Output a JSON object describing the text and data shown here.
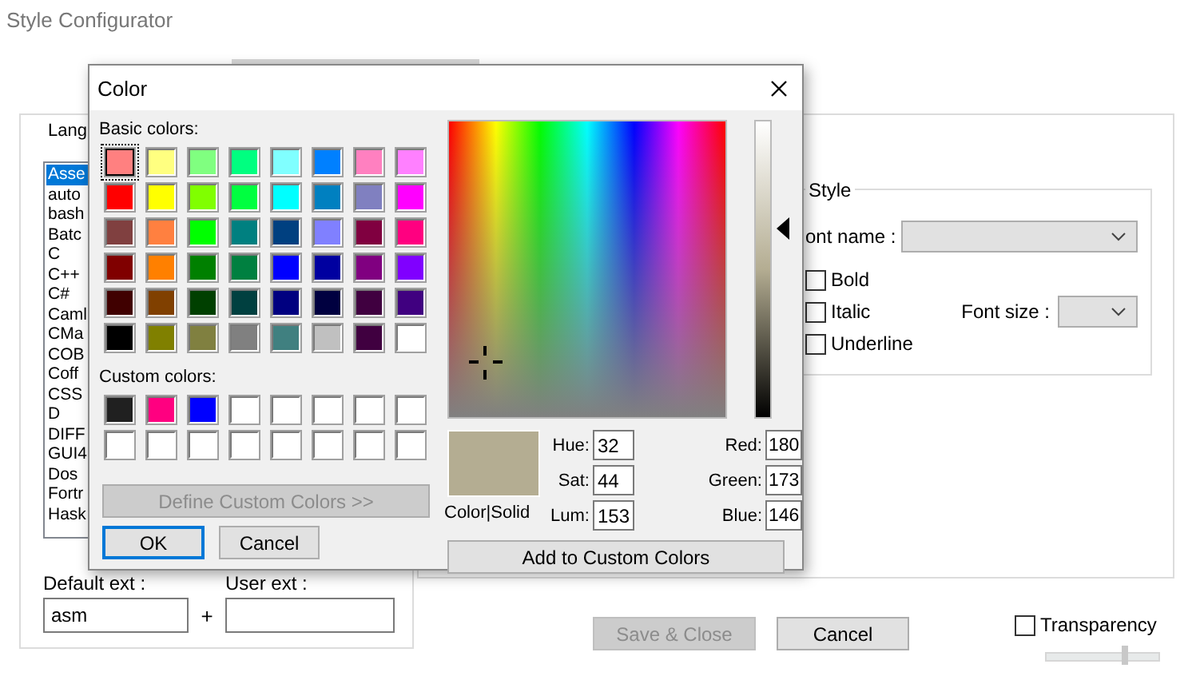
{
  "window": {
    "title": "Style Configurator"
  },
  "language_panel": {
    "label": "Lang",
    "items": [
      {
        "label": "Asse",
        "selected": true
      },
      {
        "label": "auto",
        "selected": false
      },
      {
        "label": "bash",
        "selected": false
      },
      {
        "label": "Batc",
        "selected": false
      },
      {
        "label": "C",
        "selected": false
      },
      {
        "label": "C++",
        "selected": false
      },
      {
        "label": "C#",
        "selected": false
      },
      {
        "label": "Caml",
        "selected": false
      },
      {
        "label": "CMa",
        "selected": false
      },
      {
        "label": "COB",
        "selected": false
      },
      {
        "label": "Coff",
        "selected": false
      },
      {
        "label": "CSS",
        "selected": false
      },
      {
        "label": "D",
        "selected": false
      },
      {
        "label": "DIFF",
        "selected": false
      },
      {
        "label": "GUI4",
        "selected": false
      },
      {
        "label": "Dos",
        "selected": false
      },
      {
        "label": "Fortr",
        "selected": false
      },
      {
        "label": "Hask",
        "selected": false
      }
    ],
    "default_ext": {
      "label": "Default ext :",
      "value": "asm"
    },
    "plus": "+",
    "user_ext": {
      "label": "User ext :"
    }
  },
  "style_group": {
    "title": "Style",
    "font_name_label": "ont name :",
    "options": [
      {
        "label": "Bold",
        "checked": false
      },
      {
        "label": "Italic",
        "checked": false
      },
      {
        "label": "Underline",
        "checked": false
      }
    ],
    "font_size_label": "Font size :"
  },
  "buttons": [
    {
      "label": "Save & Close",
      "disabled": true
    },
    {
      "label": "Cancel",
      "disabled": false
    }
  ],
  "transparency": {
    "label": "Transparency",
    "checked": false,
    "level": 0.7
  },
  "color_dialog": {
    "title": "Color",
    "basic_label": "Basic colors:",
    "basic_colors": [
      {
        "color": "#ff8080",
        "selected": true
      },
      {
        "color": "#ffff80",
        "selected": false
      },
      {
        "color": "#80ff80",
        "selected": false
      },
      {
        "color": "#00ff80",
        "selected": false
      },
      {
        "color": "#80ffff",
        "selected": false
      },
      {
        "color": "#0080ff",
        "selected": false
      },
      {
        "color": "#ff80c0",
        "selected": false
      },
      {
        "color": "#ff80ff",
        "selected": false
      },
      {
        "color": "#ff0000",
        "selected": false
      },
      {
        "color": "#ffff00",
        "selected": false
      },
      {
        "color": "#80ff00",
        "selected": false
      },
      {
        "color": "#00ff40",
        "selected": false
      },
      {
        "color": "#00ffff",
        "selected": false
      },
      {
        "color": "#0080c0",
        "selected": false
      },
      {
        "color": "#8080c0",
        "selected": false
      },
      {
        "color": "#ff00ff",
        "selected": false
      },
      {
        "color": "#804040",
        "selected": false
      },
      {
        "color": "#ff8040",
        "selected": false
      },
      {
        "color": "#00ff00",
        "selected": false
      },
      {
        "color": "#008080",
        "selected": false
      },
      {
        "color": "#004080",
        "selected": false
      },
      {
        "color": "#8080ff",
        "selected": false
      },
      {
        "color": "#800040",
        "selected": false
      },
      {
        "color": "#ff0080",
        "selected": false
      },
      {
        "color": "#800000",
        "selected": false
      },
      {
        "color": "#ff8000",
        "selected": false
      },
      {
        "color": "#008000",
        "selected": false
      },
      {
        "color": "#008040",
        "selected": false
      },
      {
        "color": "#0000ff",
        "selected": false
      },
      {
        "color": "#0000a0",
        "selected": false
      },
      {
        "color": "#800080",
        "selected": false
      },
      {
        "color": "#8000ff",
        "selected": false
      },
      {
        "color": "#400000",
        "selected": false
      },
      {
        "color": "#804000",
        "selected": false
      },
      {
        "color": "#004000",
        "selected": false
      },
      {
        "color": "#004040",
        "selected": false
      },
      {
        "color": "#000080",
        "selected": false
      },
      {
        "color": "#000040",
        "selected": false
      },
      {
        "color": "#400040",
        "selected": false
      },
      {
        "color": "#400080",
        "selected": false
      },
      {
        "color": "#000000",
        "selected": false
      },
      {
        "color": "#808000",
        "selected": false
      },
      {
        "color": "#808040",
        "selected": false
      },
      {
        "color": "#808080",
        "selected": false
      },
      {
        "color": "#408080",
        "selected": false
      },
      {
        "color": "#c0c0c0",
        "selected": false
      },
      {
        "color": "#400040",
        "selected": false
      },
      {
        "color": "#ffffff",
        "selected": false
      }
    ],
    "custom_label": "Custom colors:",
    "custom_colors": [
      {
        "color": "#202020"
      },
      {
        "color": "#ff0080"
      },
      {
        "color": "#0000ff"
      },
      {
        "color": "#ffffff"
      },
      {
        "color": "#ffffff"
      },
      {
        "color": "#ffffff"
      },
      {
        "color": "#ffffff"
      },
      {
        "color": "#ffffff"
      },
      {
        "color": "#ffffff"
      },
      {
        "color": "#ffffff"
      },
      {
        "color": "#ffffff"
      },
      {
        "color": "#ffffff"
      },
      {
        "color": "#ffffff"
      },
      {
        "color": "#ffffff"
      },
      {
        "color": "#ffffff"
      },
      {
        "color": "#ffffff"
      }
    ],
    "define_button": {
      "label": "Define Custom Colors >>",
      "disabled": true
    },
    "ok_button": "OK",
    "cancel_button": "Cancel",
    "preview_label": "Color|Solid",
    "fields": [
      {
        "label": "Hue:",
        "value": "32"
      },
      {
        "label": "Red:",
        "value": "180"
      },
      {
        "label": "Sat:",
        "value": "44"
      },
      {
        "label": "Green:",
        "value": "173"
      },
      {
        "label": "Lum:",
        "value": "153"
      },
      {
        "label": "Blue:",
        "value": "146"
      }
    ],
    "add_button": "Add to Custom Colors"
  }
}
